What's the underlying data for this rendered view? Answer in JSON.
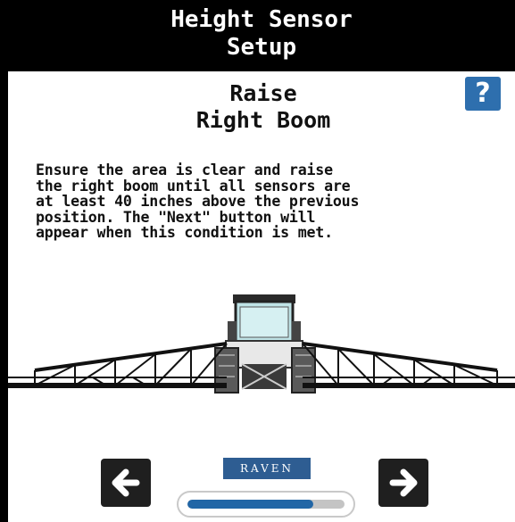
{
  "header": {
    "title_line1": "Height Sensor",
    "title_line2": "Setup"
  },
  "step": {
    "title_line1": "Raise",
    "title_line2": "Right Boom"
  },
  "help": {
    "label": "?"
  },
  "instructions": "Ensure the area is clear and raise\nthe right boom until all sensors are\nat least 40 inches above the previous\nposition. The \"Next\" button will\nappear when this condition is met.",
  "illustration": {
    "subject": "sprayer-with-booms"
  },
  "navigation": {
    "back_icon": "arrow-left-icon",
    "next_icon": "arrow-right-icon"
  },
  "brand": {
    "logo_text": "RAVEN",
    "color": "#2e5d92"
  },
  "progress": {
    "fraction": 0.8,
    "color": "#2166a6"
  }
}
